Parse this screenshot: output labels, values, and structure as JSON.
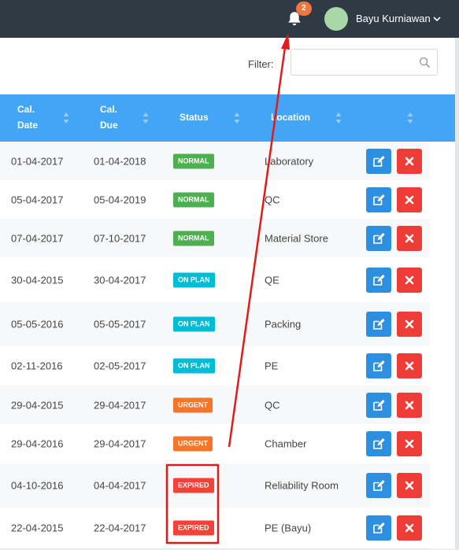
{
  "header": {
    "notification_count": "2",
    "user_name": "Bayu Kurniawan",
    "icons": {
      "bell": "bell-icon",
      "user_menu": "chevron-down-icon"
    }
  },
  "filter": {
    "label": "Filter:",
    "value": "",
    "placeholder": ""
  },
  "table": {
    "columns": [
      {
        "line1": "Cal.",
        "line2": "Date"
      },
      {
        "line1": "Cal.",
        "line2": "Due"
      },
      {
        "line1": "Status",
        "line2": ""
      },
      {
        "line1": "Location",
        "line2": ""
      },
      {
        "line1": "",
        "line2": ""
      }
    ],
    "rows": [
      {
        "cal_date": "01-04-2017",
        "cal_due": "01-04-2018",
        "status": "NORMAL",
        "location": "Laboratory"
      },
      {
        "cal_date": "05-04-2017",
        "cal_due": "05-04-2019",
        "status": "NORMAL",
        "location": "QC"
      },
      {
        "cal_date": "07-04-2017",
        "cal_due": "07-10-2017",
        "status": "NORMAL",
        "location": "Material Store"
      },
      {
        "cal_date": "30-04-2015",
        "cal_due": "30-04-2017",
        "status": "ON PLAN",
        "location": "QE"
      },
      {
        "cal_date": "05-05-2016",
        "cal_due": "05-05-2017",
        "status": "ON PLAN",
        "location": "Packing"
      },
      {
        "cal_date": "02-11-2016",
        "cal_due": "02-05-2017",
        "status": "ON PLAN",
        "location": "PE"
      },
      {
        "cal_date": "29-04-2015",
        "cal_due": "29-04-2017",
        "status": "URGENT",
        "location": "QC"
      },
      {
        "cal_date": "29-04-2016",
        "cal_due": "29-04-2017",
        "status": "URGENT",
        "location": "Chamber"
      },
      {
        "cal_date": "04-10-2016",
        "cal_due": "04-04-2017",
        "status": "EXPIRED",
        "location": "Reliability Room"
      },
      {
        "cal_date": "22-04-2015",
        "cal_due": "22-04-2017",
        "status": "EXPIRED",
        "location": "PE (Bayu)"
      }
    ]
  },
  "status_colors": {
    "NORMAL": "#4caf50",
    "ON PLAN": "#00bcd4",
    "URGENT": "#f4762a",
    "EXPIRED": "#f44336"
  },
  "colors": {
    "topbar": "#2f3a44",
    "table_header": "#42a5f5",
    "edit_button": "#2c8fe0",
    "delete_button": "#ef3c36",
    "annotation": "#e01b1b"
  },
  "row_icons": {
    "edit": "edit-icon",
    "delete": "close-icon"
  }
}
